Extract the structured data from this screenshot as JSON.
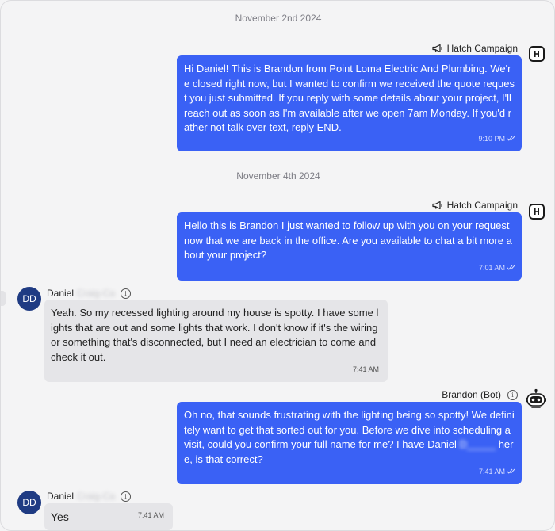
{
  "dates": [
    "November 2nd 2024",
    "November 4th 2024"
  ],
  "messages": [
    {
      "sender": "Hatch Campaign",
      "text": "Hi Daniel! This is Brandon from Point Loma Electric And Plumbing. We're closed right now, but I wanted to confirm we received the quote request you just submitted. If you reply with some details about your project, I'll reach out as soon as I'm available after we open 7am Monday. If you'd rather not talk over text, reply END.",
      "time": "9:10 PM"
    },
    {
      "sender": "Hatch Campaign",
      "text": "Hello this is Brandon I just wanted to follow up with you on your request now that we are back in the office. Are you available to chat a bit more about your project?",
      "time": "7:01 AM"
    },
    {
      "sender": "Daniel",
      "sender_hidden": "Craig-Ca",
      "avatar": "DD",
      "text": "Yeah. So my recessed lighting around my house is spotty. I have some lights that are out and some lights that work. I don't know if it's the wiring or something that's disconnected, but I need an electrician to come and check it out.",
      "time": "7:41 AM"
    },
    {
      "sender": "Brandon (Bot)",
      "text_before": "Oh no, that sounds frustrating with the lighting being so spotty! We definitely want to get that sorted out for you. Before we dive into scheduling a visit, could you confirm your full name for me? I have Daniel ",
      "text_hidden": "D_____",
      "text_after": " here, is that correct?",
      "time": "7:41 AM"
    },
    {
      "sender": "Daniel",
      "sender_hidden": "Craig-Ca",
      "avatar": "DD",
      "text": "Yes",
      "time": "7:41 AM"
    }
  ],
  "icons": {
    "megaphone": "megaphone-icon",
    "hatch_logo": "hatch-logo-icon",
    "info": "info-icon",
    "bot": "robot-icon",
    "read_receipt": "double-check-icon"
  },
  "colors": {
    "outgoing_bubble": "#3a61f5",
    "incoming_bubble": "#e5e5e8",
    "avatar_bg": "#1f3b83",
    "background": "#f4f4f5"
  }
}
